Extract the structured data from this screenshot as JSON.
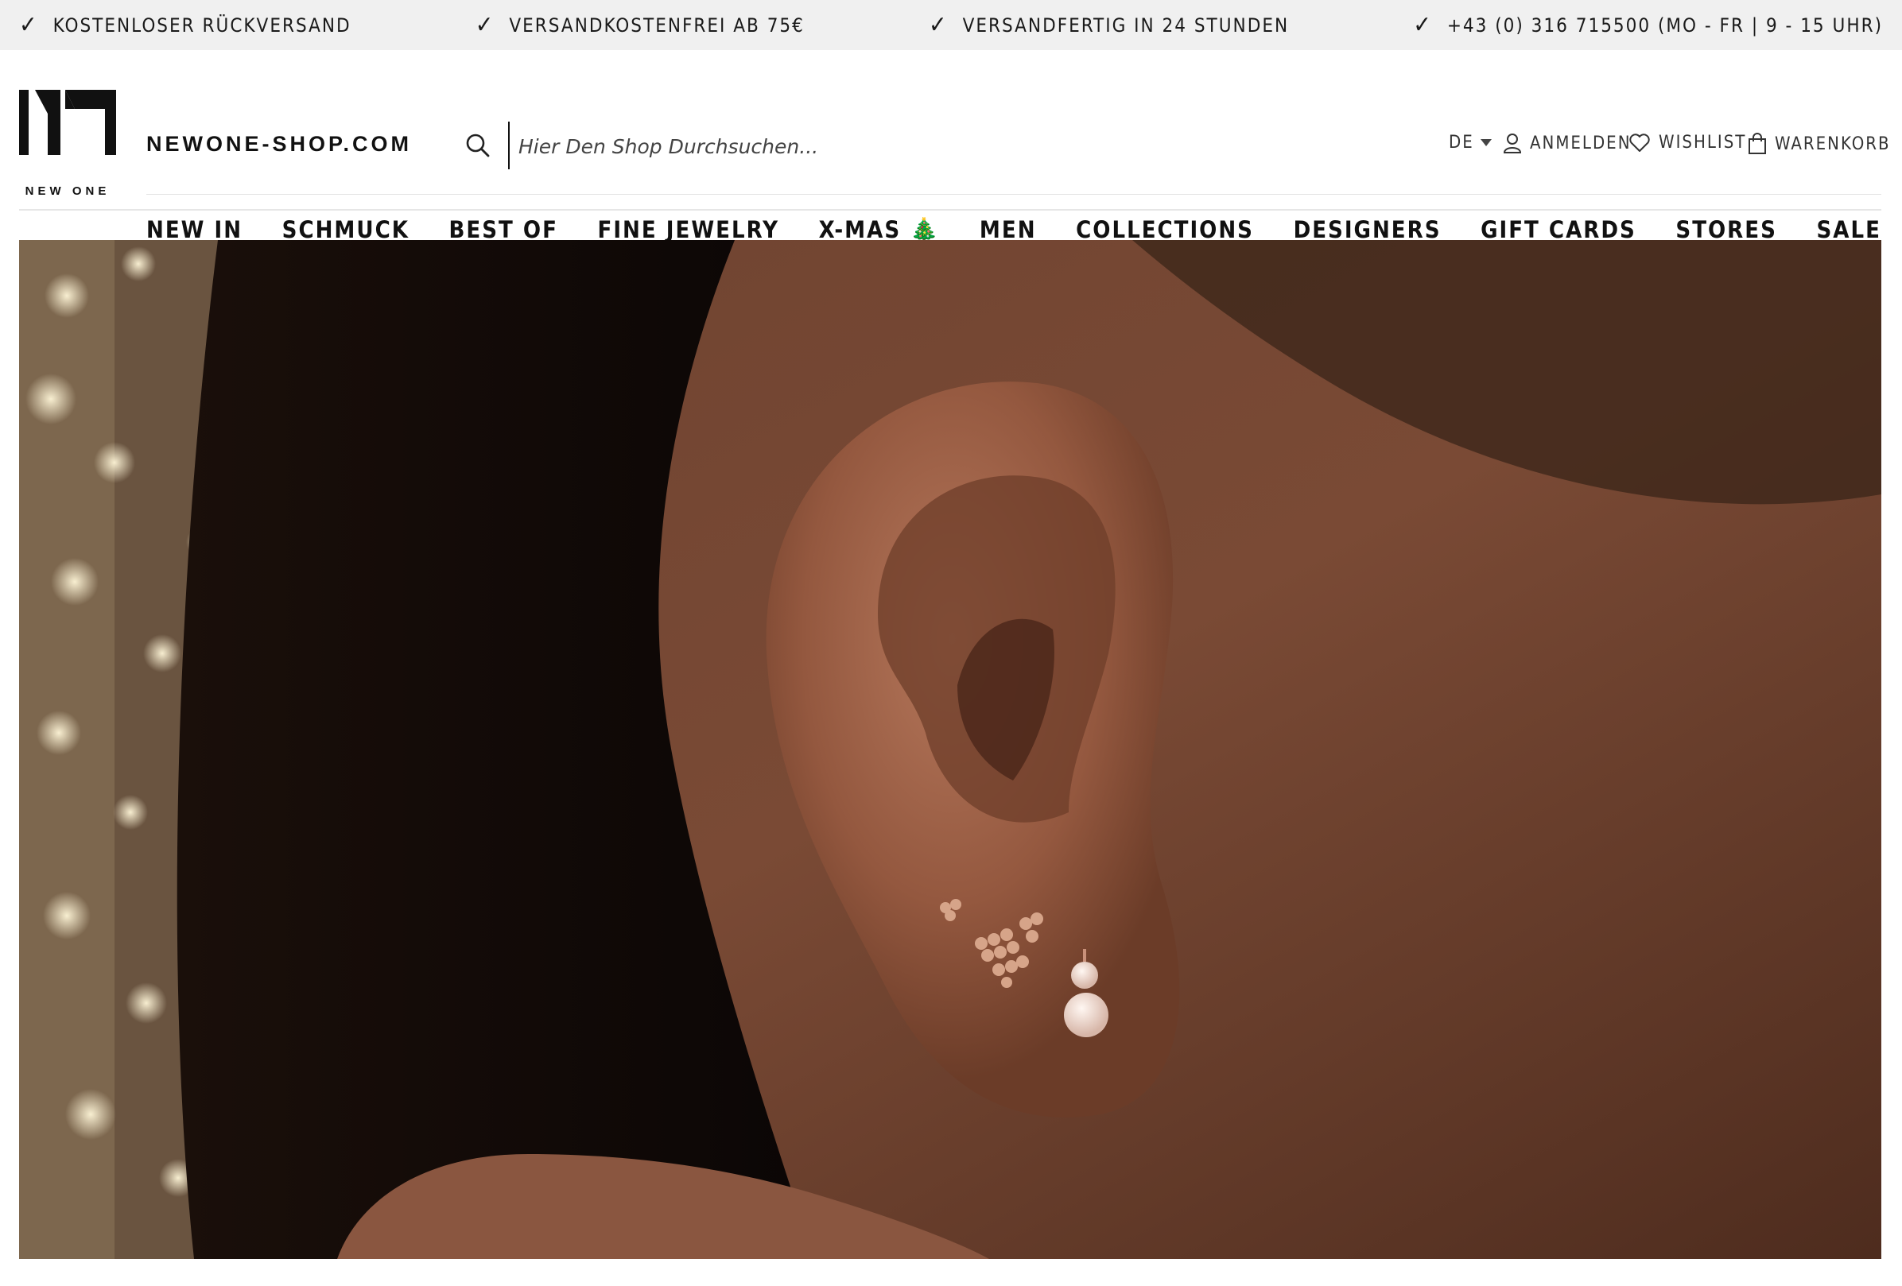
{
  "usp_bar": {
    "items": [
      "KOSTENLOSER RÜCKVERSAND",
      "VERSANDKOSTENFREI AB 75€",
      "VERSANDFERTIG IN 24 STUNDEN",
      "+43 (0) 316 715500 (MO - FR | 9 - 15 UHR)"
    ],
    "check_glyph": "✓"
  },
  "header": {
    "logo_text": "NEW ONE",
    "brand_url": "NEWONE-SHOP.COM",
    "search_placeholder": "Hier Den Shop Durchsuchen...",
    "language": "DE",
    "login_label": "ANMELDEN",
    "wishlist_label": "WISHLIST",
    "cart_label": "WARENKORB"
  },
  "nav": {
    "items": [
      "NEW IN",
      "SCHMUCK",
      "BEST OF",
      "FINE JEWELRY",
      "X-MAS 🎄",
      "MEN",
      "COLLECTIONS",
      "DESIGNERS",
      "GIFT CARDS",
      "STORES",
      "SALE"
    ]
  },
  "hero": {
    "icon": "hero-ear-earrings-image"
  },
  "colors": {
    "usp_background": "#f0f0f0",
    "text": "#111111"
  }
}
